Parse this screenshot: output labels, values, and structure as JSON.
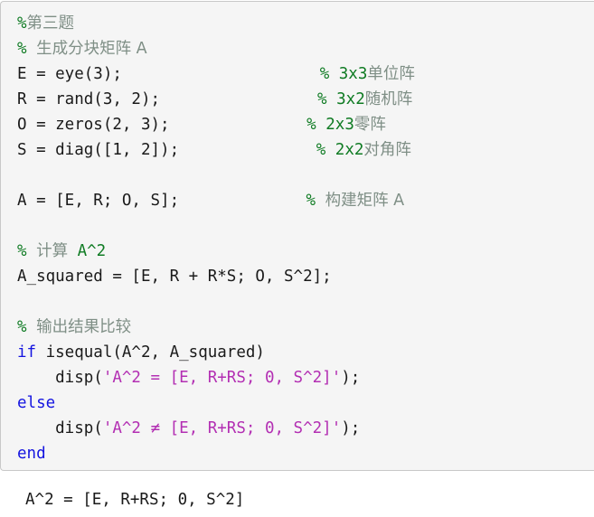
{
  "colors": {
    "background": "#ffffff",
    "code_background": "#f5f5f5",
    "code_border": "#c8c8c8",
    "comment": "#0f7b23",
    "comment_cjk": "#7f8f86",
    "keyword": "#1414e0",
    "string": "#b32fb3",
    "plain": "#1a1a1a"
  },
  "code_block": {
    "language": "matlab",
    "lines": [
      {
        "id": "l1",
        "indent": "",
        "code": "",
        "comment_ascii": "%",
        "comment_cjk": "第三题",
        "comment_inline": false
      },
      {
        "id": "l2",
        "indent": "",
        "code": "",
        "comment_ascii": "% ",
        "comment_cjk": "生成分块矩阵 A",
        "comment_inline": false
      },
      {
        "id": "l3",
        "indent": "",
        "code": "E = eye(3);",
        "comment_ascii": "% 3x3",
        "comment_cjk": "单位阵",
        "comment_inline": true
      },
      {
        "id": "l4",
        "indent": "",
        "code": "R = rand(3, 2);",
        "comment_ascii": "% 3x2",
        "comment_cjk": "随机阵",
        "comment_inline": true
      },
      {
        "id": "l5",
        "indent": "",
        "code": "O = zeros(2, 3);",
        "comment_ascii": "% 2x3",
        "comment_cjk": "零阵",
        "comment_inline": true
      },
      {
        "id": "l6",
        "indent": "",
        "code": "S = diag([1, 2]);",
        "comment_ascii": "% 2x2",
        "comment_cjk": "对角阵",
        "comment_inline": true
      },
      {
        "id": "l7",
        "indent": "",
        "code": "",
        "comment_ascii": "",
        "comment_cjk": "",
        "comment_inline": false
      },
      {
        "id": "l8",
        "indent": "",
        "code": "A = [E, R; O, S];",
        "comment_ascii": "% ",
        "comment_cjk": "构建矩阵 A",
        "comment_inline": true
      },
      {
        "id": "l9",
        "indent": "",
        "code": "",
        "comment_ascii": "",
        "comment_cjk": "",
        "comment_inline": false
      },
      {
        "id": "l10",
        "indent": "",
        "code": "",
        "comment_ascii": "% ",
        "comment_cjk": "计算",
        "comment_tail": " A^2",
        "comment_inline": false
      },
      {
        "id": "l11",
        "indent": "",
        "code": "A_squared = [E, R + R*S; O, S^2];",
        "comment_ascii": "",
        "comment_cjk": "",
        "comment_inline": false
      },
      {
        "id": "l12",
        "indent": "",
        "code": "",
        "comment_ascii": "",
        "comment_cjk": "",
        "comment_inline": false
      },
      {
        "id": "l13",
        "indent": "",
        "code": "",
        "comment_ascii": "% ",
        "comment_cjk": "输出结果比较",
        "comment_inline": false
      },
      {
        "id": "l14",
        "indent": "",
        "code": "if isequal(A^2, A_squared)",
        "keyword": "if",
        "comment_ascii": "",
        "comment_inline": false
      },
      {
        "id": "l15",
        "indent": "    ",
        "code": "disp('A^2 = [E, R+RS; 0, S^2]');",
        "string": "'A^2 = [E, R+RS; 0, S^2]'",
        "comment_ascii": "",
        "comment_inline": false
      },
      {
        "id": "l16",
        "indent": "",
        "code": "else",
        "keyword": "else",
        "comment_ascii": "",
        "comment_inline": false
      },
      {
        "id": "l17",
        "indent": "    ",
        "code": "disp('A^2 ≠ [E, R+RS; 0, S^2]');",
        "string": "'A^2 ≠ [E, R+RS; 0, S^2]'",
        "comment_ascii": "",
        "comment_inline": false
      },
      {
        "id": "l18",
        "indent": "",
        "code": "end",
        "keyword": "end",
        "comment_ascii": "",
        "comment_inline": false
      }
    ],
    "rendered": {
      "line1_comment_sym": "%",
      "line1_comment_cjk": "第三题",
      "line2_comment_sym": "% ",
      "line2_comment_cjk": "生成分块矩阵 A",
      "line3_code": "E = eye(3);",
      "line3_comment_sym": "% 3x3",
      "line3_comment_cjk": "单位阵",
      "line4_code": "R = rand(3, 2);",
      "line4_comment_sym": "% 3x2",
      "line4_comment_cjk": "随机阵",
      "line5_code": "O = zeros(2, 3);",
      "line5_comment_sym": "% 2x3",
      "line5_comment_cjk": "零阵",
      "line6_code": "S = diag([1, 2]);",
      "line6_comment_sym": "% 2x2",
      "line6_comment_cjk": "对角阵",
      "line8_code": "A = [E, R; O, S];",
      "line8_comment_sym": "% ",
      "line8_comment_cjk": "构建矩阵 A",
      "line10_comment_sym": "% ",
      "line10_comment_cjk": "计算",
      "line10_comment_tail": " A^2",
      "line11_code": "A_squared = [E, R + R*S; O, S^2];",
      "line13_comment_sym": "% ",
      "line13_comment_cjk": "输出结果比较",
      "line14_kw": "if",
      "line14_rest": " isequal(A^2, A_squared)",
      "line15_pre": "    disp(",
      "line15_str": "'A^2 = [E, R+RS; 0, S^2]'",
      "line15_post": ");",
      "line16_kw": "else",
      "line17_pre": "    disp(",
      "line17_str": "'A^2 ≠ [E, R+RS; 0, S^2]'",
      "line17_post": ");",
      "line18_kw": "end"
    }
  },
  "console_output": {
    "lines": [
      "A^2 = [E, R+RS; 0, S^2]"
    ],
    "line1": "A^2 = [E, R+RS; 0, S^2]"
  }
}
